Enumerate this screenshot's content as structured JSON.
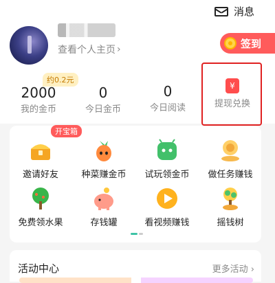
{
  "header": {
    "messages_label": "消息"
  },
  "profile": {
    "view_profile": "查看个人主页",
    "chevron": "›"
  },
  "signin": {
    "label": "签到"
  },
  "stats": {
    "badge": "约0.2元",
    "items": [
      {
        "value": "2000",
        "label": "我的金币"
      },
      {
        "value": "0",
        "label": "今日金币"
      },
      {
        "value": "0",
        "label": "今日阅读"
      }
    ],
    "withdraw": {
      "label": "提现兑换",
      "symbol": "¥"
    }
  },
  "grid": {
    "treasure_badge": "开宝箱",
    "items": [
      {
        "label": "邀请好友",
        "icon": "treasure-chest-icon"
      },
      {
        "label": "种菜赚金币",
        "icon": "carrot-icon"
      },
      {
        "label": "试玩领金币",
        "icon": "game-controller-icon"
      },
      {
        "label": "做任务赚钱",
        "icon": "task-coin-icon"
      },
      {
        "label": "免费领水果",
        "icon": "fruit-tree-icon"
      },
      {
        "label": "存钱罐",
        "icon": "piggy-bank-icon"
      },
      {
        "label": "看视频赚钱",
        "icon": "play-video-icon"
      },
      {
        "label": "摇钱树",
        "icon": "money-tree-icon"
      }
    ]
  },
  "activity": {
    "title": "活动中心",
    "more": "更多活动 ›"
  }
}
